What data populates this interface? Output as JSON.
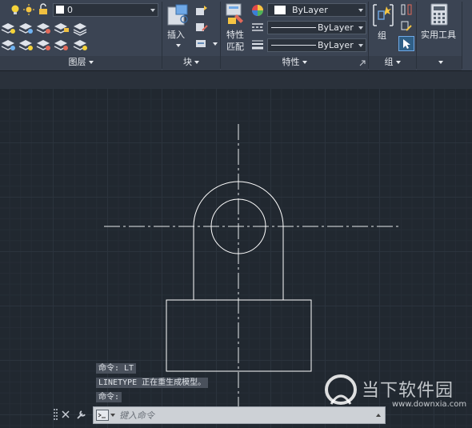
{
  "ribbon": {
    "layers": {
      "title": "图层",
      "layer_combo_value": "0"
    },
    "block": {
      "title": "块",
      "insert_label": "插入"
    },
    "properties": {
      "title": "特性",
      "match_label_line1": "特性",
      "match_label_line2": "匹配",
      "color_value": "ByLayer",
      "linetype_value": "ByLayer",
      "lineweight_value": "ByLayer"
    },
    "groups": {
      "title": "组",
      "group_label": "组"
    },
    "utilities": {
      "label": "实用工具"
    }
  },
  "command_history": [
    "命令: LT",
    "LINETYPE 正在重生成模型。",
    "命令:"
  ],
  "command_line": {
    "placeholder": "键入命令"
  },
  "watermark": {
    "cn": "当下软件园",
    "url": "www.downxia.com"
  },
  "colors": {
    "ribbon_bg": "#3b4453",
    "canvas_bg": "#212830",
    "geometry": "#ffffff"
  }
}
